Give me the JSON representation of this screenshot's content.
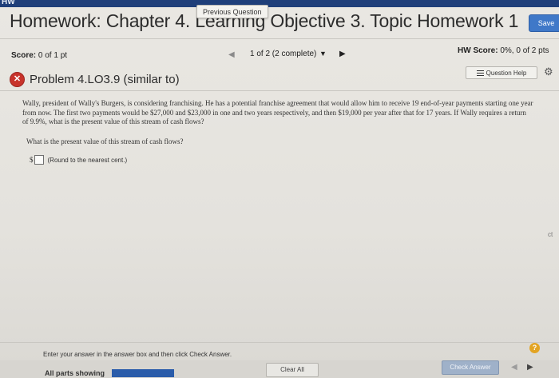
{
  "top_strip": {
    "text": "HW"
  },
  "header": {
    "title": "Homework: Chapter 4. Learning Objective 3. Topic Homework 1",
    "previous_question_tooltip": "Previous Question",
    "save_label": "Save"
  },
  "status": {
    "score_label": "Score:",
    "score_value": "0 of 1 pt",
    "question_nav": {
      "prev_icon": "triangle-left-icon",
      "count": "1 of 2 (2 complete)",
      "dropdown_icon": "dropdown-triangle-icon",
      "next_icon": "triangle-right-icon"
    },
    "hw_score_label": "HW Score:",
    "hw_score_value": "0%, 0 of 2 pts"
  },
  "problem": {
    "status_icon": "incorrect-x-icon",
    "title": "Problem 4.LO3.9 (similar to)",
    "help_label": "Question Help",
    "gear_icon": "gear-icon",
    "text": "Wally, president of Wally's Burgers, is considering franchising. He has a potential franchise agreement that would allow him to receive 19 end-of-year payments starting one year from now. The first two payments would be $27,000 and $23,000 in one and two years respectively, and then $19,000 per year after that for 17 years. If Wally requires a return of 9.9%, what is the present value of this stream of cash flows?",
    "question": "What is the present value of this stream of cash flows?",
    "answer": {
      "prefix": "$",
      "value": "",
      "hint": "(Round to the nearest cent.)"
    }
  },
  "footer": {
    "instruction": "Enter your answer in the answer box and then click Check Answer.",
    "help_bubble": "?",
    "all_parts_label": "All parts showing",
    "clear_all_label": "Clear All",
    "check_answer_label": "Check Answer",
    "prev_icon": "triangle-left-icon",
    "next_icon": "triangle-right-icon",
    "side_cut_text": "ct"
  },
  "colors": {
    "accent": "#3f78c8",
    "incorrect": "#c8332b",
    "help_bubble": "#e3a423",
    "progress": "#2a5caa"
  }
}
